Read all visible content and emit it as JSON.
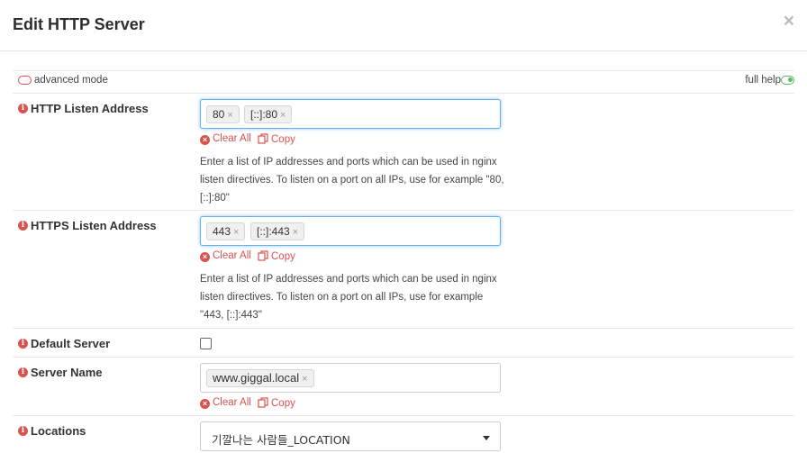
{
  "modal": {
    "title": "Edit HTTP Server",
    "close": "×"
  },
  "toggles": {
    "advanced_label": "advanced mode",
    "help_label": "full help"
  },
  "actions": {
    "clear_all": "Clear All",
    "copy": "Copy"
  },
  "fields": {
    "http_listen": {
      "label": "HTTP Listen Address",
      "tags": [
        "80",
        "[::]:80"
      ],
      "help": "Enter a list of IP addresses and ports which can be used in nginx listen directives. To listen on a port on all IPs, use for example \"80, [::]:80\""
    },
    "https_listen": {
      "label": "HTTPS Listen Address",
      "tags": [
        "443",
        "[::]:443"
      ],
      "help": "Enter a list of IP addresses and ports which can be used in nginx listen directives. To listen on a port on all IPs, use for example \"443, [::]:443\""
    },
    "default_server": {
      "label": "Default Server",
      "checked": false
    },
    "server_name": {
      "label": "Server Name",
      "tags": [
        "www.giggal.local"
      ]
    },
    "locations": {
      "label": "Locations",
      "selected": "기깔나는 사람들_LOCATION"
    }
  },
  "colors": {
    "accent_red": "#d9534f",
    "toggle_green": "#5cb85c",
    "focus_blue": "#66afe9"
  }
}
